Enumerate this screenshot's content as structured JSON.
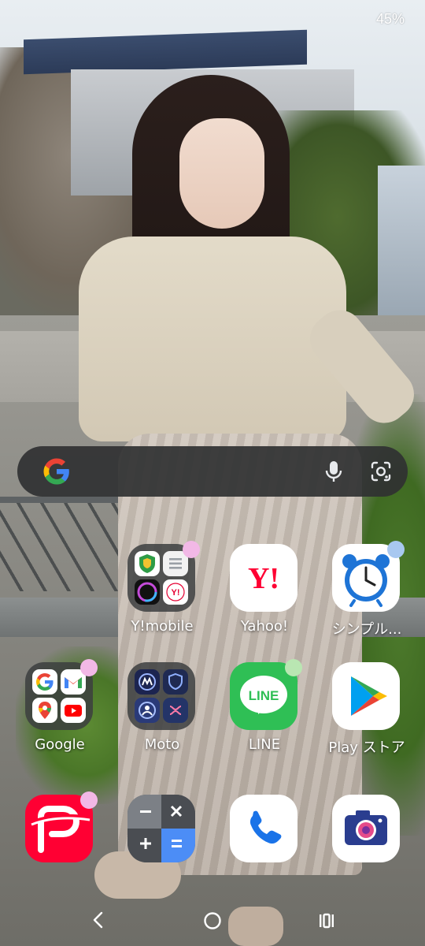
{
  "status_bar": {
    "battery": "45%"
  },
  "search": {
    "logo": "google-g-icon",
    "mic_icon": "mic-icon",
    "lens_icon": "google-lens-icon"
  },
  "colors": {
    "search_bg": "#303132",
    "badge_pink": "#f2b8e6",
    "badge_blue": "#a8c8f0",
    "badge_green": "#b9e6b2",
    "line_green": "#2fbf55",
    "yahoo_red": "#ff0033",
    "paypay_red": "#ff0033",
    "clock_blue": "#1e74d6"
  },
  "apps": {
    "row1": [
      {
        "label": "Y!mobile",
        "type": "folder",
        "badge": "pink"
      },
      {
        "label": "Yahoo!",
        "type": "app",
        "icon": "yahoo-icon"
      },
      {
        "label": "シンプル...",
        "type": "app",
        "icon": "alarm-clock-icon",
        "badge": "blue"
      }
    ],
    "row2": [
      {
        "label": "Google",
        "type": "folder",
        "badge": "pink"
      },
      {
        "label": "Moto",
        "type": "folder"
      },
      {
        "label": "LINE",
        "type": "app",
        "icon": "line-icon",
        "icon_text": "LINE",
        "badge": "green"
      },
      {
        "label": "Play ストア",
        "type": "app",
        "icon": "play-store-icon"
      }
    ],
    "row3": [
      {
        "label": "",
        "type": "app",
        "icon": "paypay-icon",
        "badge": "pink"
      },
      {
        "label": "",
        "type": "app",
        "icon": "calculator-icon"
      },
      {
        "label": "",
        "type": "app",
        "icon": "phone-icon"
      },
      {
        "label": "",
        "type": "app",
        "icon": "camera-icon"
      }
    ]
  },
  "icon_text": {
    "yahoo": "Y!",
    "line": "LINE",
    "ymobile_mini": "Y!"
  },
  "nav": {
    "back": "back-icon",
    "home": "home-icon",
    "recents": "recents-icon"
  }
}
